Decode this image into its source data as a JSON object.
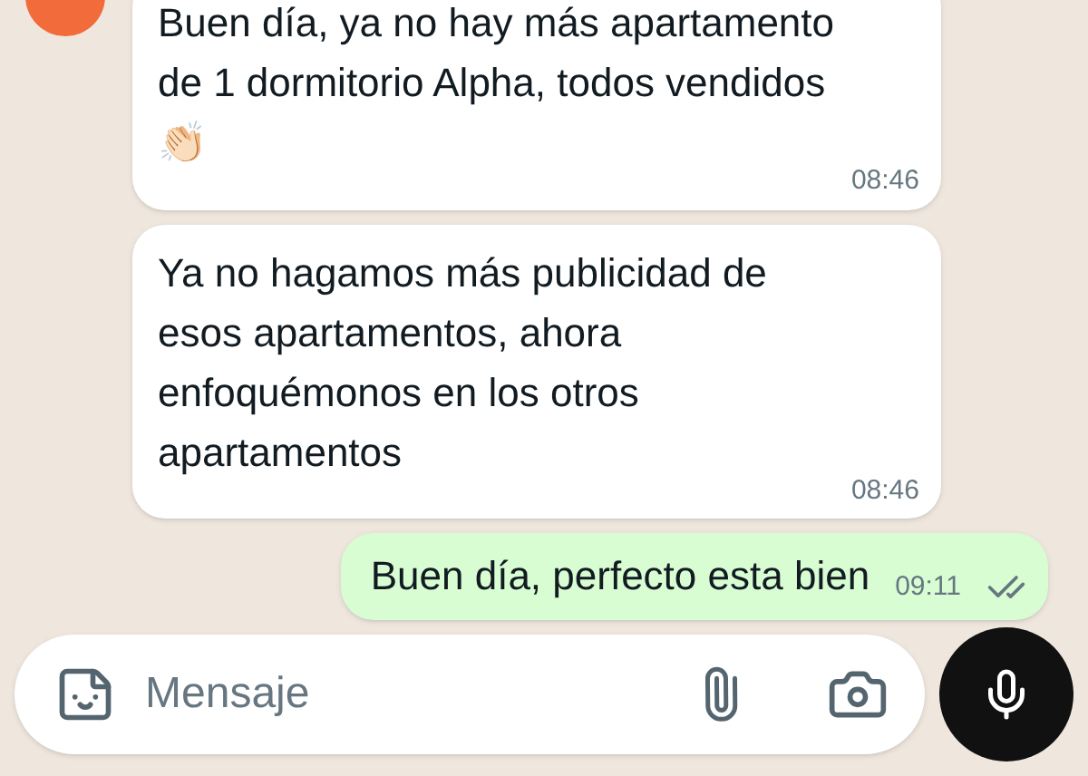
{
  "messages": [
    {
      "kind": "incoming",
      "text": "Buen día, ya no hay más apartamento de 1 dormitorio Alpha, todos vendidos👏🏻",
      "time": "08:46"
    },
    {
      "kind": "incoming",
      "text": "Ya no hagamos más publicidad de esos apartamentos, ahora enfoquémonos en los otros apartamentos",
      "time": "08:46"
    },
    {
      "kind": "outgoing",
      "text": "Buen día, perfecto esta bien",
      "time": "09:11",
      "read": false
    }
  ],
  "composer": {
    "placeholder": "Mensaje"
  }
}
